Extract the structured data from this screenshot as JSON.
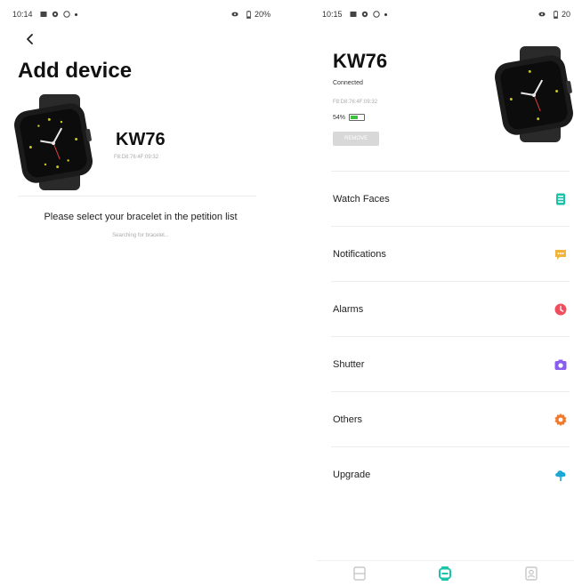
{
  "left_screen": {
    "status": {
      "time": "10:14",
      "battery": "20%"
    },
    "title": "Add device",
    "device": {
      "name": "KW76",
      "mac": "F8:D8:76:4F:09:32"
    },
    "instruction": "Please select your bracelet in the petition list",
    "searching": "Searching for bracelet..."
  },
  "right_screen": {
    "status": {
      "time": "10:15",
      "battery": "20"
    },
    "device": {
      "name": "KW76",
      "status": "Connected",
      "mac": "F8:D8:76:4F:09:32",
      "battery_label": "54%",
      "battery_level": 0.54,
      "remove_label": "REMOVE"
    },
    "menu": [
      {
        "label": "Watch Faces",
        "icon": "watch-faces-icon",
        "color": "#19c2a8"
      },
      {
        "label": "Notifications",
        "icon": "notifications-icon",
        "color": "#f2b33d"
      },
      {
        "label": "Alarms",
        "icon": "alarm-icon",
        "color": "#f04e5e"
      },
      {
        "label": "Shutter",
        "icon": "camera-icon",
        "color": "#8a5cf0"
      },
      {
        "label": "Others",
        "icon": "gear-icon",
        "color": "#f07a2b"
      },
      {
        "label": "Upgrade",
        "icon": "upgrade-icon",
        "color": "#1aa9d6"
      }
    ],
    "tabs": [
      {
        "icon": "home-tab-icon",
        "active": false
      },
      {
        "icon": "device-tab-icon",
        "active": true
      },
      {
        "icon": "profile-tab-icon",
        "active": false
      }
    ]
  },
  "colors": {
    "accent": "#19c2a8",
    "battery_green": "#3fbf3f",
    "inactive_tab": "#c8c8c8"
  }
}
